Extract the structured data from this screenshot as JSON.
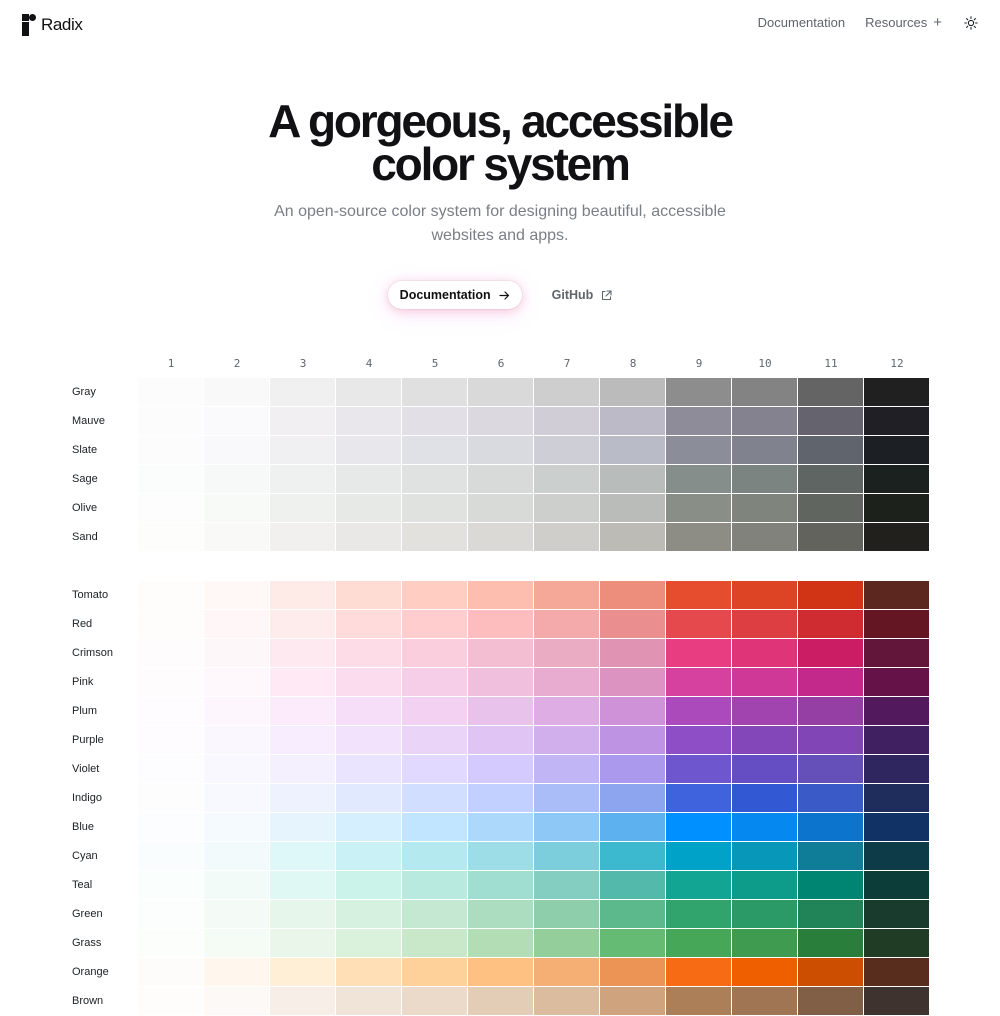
{
  "header": {
    "logo_text": "Radix",
    "nav": {
      "documentation": "Documentation",
      "resources": "Resources"
    },
    "icons": {
      "logo": "radix-logo-icon",
      "resources": "plus-icon",
      "theme": "sun-icon"
    }
  },
  "hero": {
    "title_line1": "A gorgeous, accessible",
    "title_line2": "color system",
    "subtitle_line1": "An open-source color system for designing beautiful, accessible",
    "subtitle_line2": "websites and apps.",
    "docs_button": "Documentation",
    "github_button": "GitHub",
    "icons": {
      "docs_button": "arrow-right-icon",
      "github_button": "external-link-icon"
    }
  },
  "grid": {
    "columns": [
      "1",
      "2",
      "3",
      "4",
      "5",
      "6",
      "7",
      "8",
      "9",
      "10",
      "11",
      "12"
    ],
    "groups": [
      {
        "scales": [
          {
            "name": "Gray",
            "colors": [
              "#fcfcfc",
              "#f9f9f9",
              "#f0f0f0",
              "#e8e8e8",
              "#e0e0e0",
              "#d9d9d9",
              "#cecece",
              "#bbbbbb",
              "#8d8d8d",
              "#838383",
              "#646464",
              "#202020"
            ]
          },
          {
            "name": "Mauve",
            "colors": [
              "#fdfcfd",
              "#faf9fb",
              "#f2eff3",
              "#eae7ec",
              "#e3dfe6",
              "#dbd8e0",
              "#d0cdd7",
              "#bcbac7",
              "#8e8c99",
              "#84828e",
              "#65636d",
              "#211f26"
            ]
          },
          {
            "name": "Slate",
            "colors": [
              "#fcfcfd",
              "#f9f9fb",
              "#f0f0f3",
              "#e8e8ec",
              "#e0e1e6",
              "#d9d9e0",
              "#cdced6",
              "#b9bbc6",
              "#8b8d98",
              "#80838d",
              "#60646c",
              "#1c2024"
            ]
          },
          {
            "name": "Sage",
            "colors": [
              "#fbfdfc",
              "#f7f9f8",
              "#eef1f0",
              "#e6e9e8",
              "#dfe2e0",
              "#d7dad9",
              "#cbcfcd",
              "#b8bcba",
              "#868e8b",
              "#7c8481",
              "#5f6563",
              "#1a211e"
            ]
          },
          {
            "name": "Olive",
            "colors": [
              "#fcfdfc",
              "#f8faf8",
              "#eff1ef",
              "#e7e9e7",
              "#dfe2df",
              "#d7dad7",
              "#cccfcc",
              "#b9bcb8",
              "#898e87",
              "#7f847d",
              "#60655f",
              "#1d211c"
            ]
          },
          {
            "name": "Sand",
            "colors": [
              "#fdfdfc",
              "#f9f9f8",
              "#f1f0ef",
              "#e9e8e6",
              "#e2e1de",
              "#dad9d6",
              "#cfceca",
              "#bcbbb5",
              "#8d8d86",
              "#82827c",
              "#63635e",
              "#21201c"
            ]
          }
        ]
      },
      {
        "scales": [
          {
            "name": "Tomato",
            "colors": [
              "#fffcfc",
              "#fff8f7",
              "#feebe7",
              "#ffdcd3",
              "#ffcdc2",
              "#fdbdaf",
              "#f5a898",
              "#ec8e7b",
              "#e54d2e",
              "#dd4425",
              "#d13415",
              "#5c271f"
            ]
          },
          {
            "name": "Red",
            "colors": [
              "#fffcfc",
              "#fff7f7",
              "#feebec",
              "#ffdbdc",
              "#ffcdce",
              "#fdbdbe",
              "#f4a9aa",
              "#eb8e90",
              "#e5484d",
              "#dc3e42",
              "#ce2c31",
              "#641723"
            ]
          },
          {
            "name": "Crimson",
            "colors": [
              "#fffcfd",
              "#fef7f9",
              "#ffe9f0",
              "#fedce7",
              "#facedd",
              "#f3bed1",
              "#eaacc3",
              "#e093b2",
              "#e93d82",
              "#df3478",
              "#cb1d63",
              "#621639"
            ]
          },
          {
            "name": "Pink",
            "colors": [
              "#fffcfe",
              "#fef7fb",
              "#fee9f5",
              "#fbdcef",
              "#f6cee7",
              "#efbfdd",
              "#e7acd0",
              "#dd93c2",
              "#d6409f",
              "#cf3897",
              "#c2298a",
              "#651249"
            ]
          },
          {
            "name": "Plum",
            "colors": [
              "#fefcff",
              "#fdf7fd",
              "#fbebfb",
              "#f7def8",
              "#f2d1f3",
              "#e9c2ec",
              "#deade3",
              "#cf91d8",
              "#ab4aba",
              "#a144af",
              "#953ea3",
              "#53195d"
            ]
          },
          {
            "name": "Purple",
            "colors": [
              "#fefcfe",
              "#fbf7fe",
              "#f7edfe",
              "#f2e2fc",
              "#ead5f9",
              "#e0c4f4",
              "#d1afec",
              "#be93e4",
              "#8e4ec6",
              "#8347b9",
              "#8145b5",
              "#402060"
            ]
          },
          {
            "name": "Violet",
            "colors": [
              "#fdfcfe",
              "#faf8ff",
              "#f4f0fe",
              "#ebe4ff",
              "#e1d9ff",
              "#d4cafe",
              "#c2b5f5",
              "#aa99ec",
              "#6e56cf",
              "#654dc4",
              "#6550b9",
              "#2f265f"
            ]
          },
          {
            "name": "Indigo",
            "colors": [
              "#fdfdfe",
              "#f7f9ff",
              "#edf2fe",
              "#e1e9ff",
              "#d2deff",
              "#c1d0ff",
              "#abbdf9",
              "#8da4ef",
              "#3e63dd",
              "#3358d4",
              "#3a5bc7",
              "#1f2d5c"
            ]
          },
          {
            "name": "Blue",
            "colors": [
              "#fbfdff",
              "#f4faff",
              "#e6f4fe",
              "#d5efff",
              "#c2e5ff",
              "#acd8fc",
              "#8ec8f6",
              "#5eb1ef",
              "#0090ff",
              "#0588f0",
              "#0d74ce",
              "#113264"
            ]
          },
          {
            "name": "Cyan",
            "colors": [
              "#fafdfe",
              "#f2fafb",
              "#def7f9",
              "#caf1f6",
              "#b5e9f0",
              "#9ddde7",
              "#7dcedc",
              "#3db9cf",
              "#00a2c7",
              "#0797b9",
              "#107d98",
              "#0d3c48"
            ]
          },
          {
            "name": "Teal",
            "colors": [
              "#fafefd",
              "#f3fbf9",
              "#e0f8f3",
              "#ccf3ea",
              "#b8eae0",
              "#a1ded2",
              "#83cdc1",
              "#53b9ab",
              "#12a594",
              "#0d9b8a",
              "#008573",
              "#0d3d38"
            ]
          },
          {
            "name": "Green",
            "colors": [
              "#fbfefc",
              "#f4fbf6",
              "#e6f6eb",
              "#d6f1df",
              "#c4e8d1",
              "#adddc0",
              "#8eceaa",
              "#5bb98b",
              "#30a46c",
              "#2b9a66",
              "#218358",
              "#193b2d"
            ]
          },
          {
            "name": "Grass",
            "colors": [
              "#fbfefb",
              "#f5fbf5",
              "#e9f6e9",
              "#daf1db",
              "#c9e8ca",
              "#b2ddb5",
              "#94ce9a",
              "#65ba74",
              "#46a758",
              "#3e9b4f",
              "#2a7e3b",
              "#203c25"
            ]
          },
          {
            "name": "Orange",
            "colors": [
              "#fefcfb",
              "#fff7ed",
              "#ffefd6",
              "#ffdfb5",
              "#ffd19a",
              "#ffc182",
              "#f5ae73",
              "#ec9455",
              "#f76b15",
              "#ef5f00",
              "#cc4e00",
              "#582d1d"
            ]
          },
          {
            "name": "Brown",
            "colors": [
              "#fefdfc",
              "#fcf9f6",
              "#f6eee7",
              "#f0e4d9",
              "#ebdaca",
              "#e4cdb7",
              "#dcbc9f",
              "#cea37e",
              "#ad7f58",
              "#a07553",
              "#815e46",
              "#3e332e"
            ]
          }
        ]
      }
    ]
  }
}
